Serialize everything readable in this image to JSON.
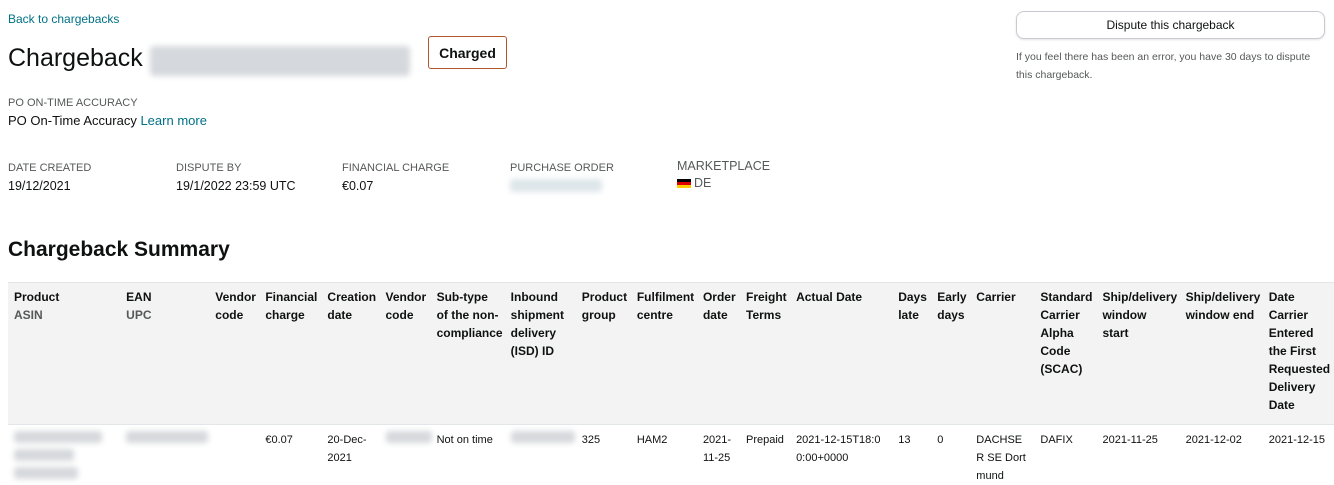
{
  "back_link": "Back to chargebacks",
  "header": {
    "title": "Chargeback",
    "status": "Charged",
    "type_caption": "PO ON-TIME ACCURACY",
    "type_value": "PO On-Time Accuracy",
    "learn_more": "Learn more"
  },
  "dispute": {
    "button_label": "Dispute this chargeback",
    "note": "If you feel there has been an error, you have 30 days to dispute this chargeback."
  },
  "meta": {
    "date_created_label": "DATE CREATED",
    "date_created": "19/12/2021",
    "dispute_by_label": "DISPUTE BY",
    "dispute_by": "19/1/2022 23:59 UTC",
    "financial_charge_label": "FINANCIAL CHARGE",
    "financial_charge": "€0.07",
    "purchase_order_label": "PURCHASE ORDER",
    "marketplace_label": "MARKETPLACE",
    "marketplace": "DE"
  },
  "summary": {
    "title": "Chargeback Summary",
    "columns": [
      {
        "label": "Product",
        "sub": "ASIN"
      },
      {
        "label": "EAN",
        "sub": "UPC"
      },
      {
        "label": "Vendor code",
        "sub": ""
      },
      {
        "label": "Financial charge",
        "sub": ""
      },
      {
        "label": "Creation date",
        "sub": ""
      },
      {
        "label": "Vendor code",
        "sub": ""
      },
      {
        "label": "Sub-type of the non-compliance",
        "sub": ""
      },
      {
        "label": "Inbound shipment delivery (ISD) ID",
        "sub": ""
      },
      {
        "label": "Product group",
        "sub": ""
      },
      {
        "label": "Fulfilment centre",
        "sub": ""
      },
      {
        "label": "Order date",
        "sub": ""
      },
      {
        "label": "Freight Terms",
        "sub": ""
      },
      {
        "label": "Actual Date",
        "sub": ""
      },
      {
        "label": "Days late",
        "sub": ""
      },
      {
        "label": "Early days",
        "sub": ""
      },
      {
        "label": "Carrier",
        "sub": ""
      },
      {
        "label": "Standard Carrier Alpha Code (SCAC)",
        "sub": ""
      },
      {
        "label": "Ship/delivery window start",
        "sub": ""
      },
      {
        "label": "Ship/delivery window end",
        "sub": ""
      },
      {
        "label": "Date Carrier Entered the First Requested Delivery Date",
        "sub": ""
      }
    ],
    "row": {
      "financial_charge": "€0.07",
      "creation_date": "20-Dec-2021",
      "sub_type": "Not on time",
      "product_group": "325",
      "fulfilment_centre": "HAM2",
      "order_date": "2021-11-25",
      "freight_terms": "Prepaid",
      "actual_date": "2021-12-15T18:00:00+0000",
      "days_late": "13",
      "early_days": "0",
      "carrier": "DACHSER SE Dortmund",
      "scac": "DAFIX",
      "window_start": "2021-11-25",
      "window_end": "2021-12-02",
      "first_requested_date": "2021-12-15"
    }
  }
}
